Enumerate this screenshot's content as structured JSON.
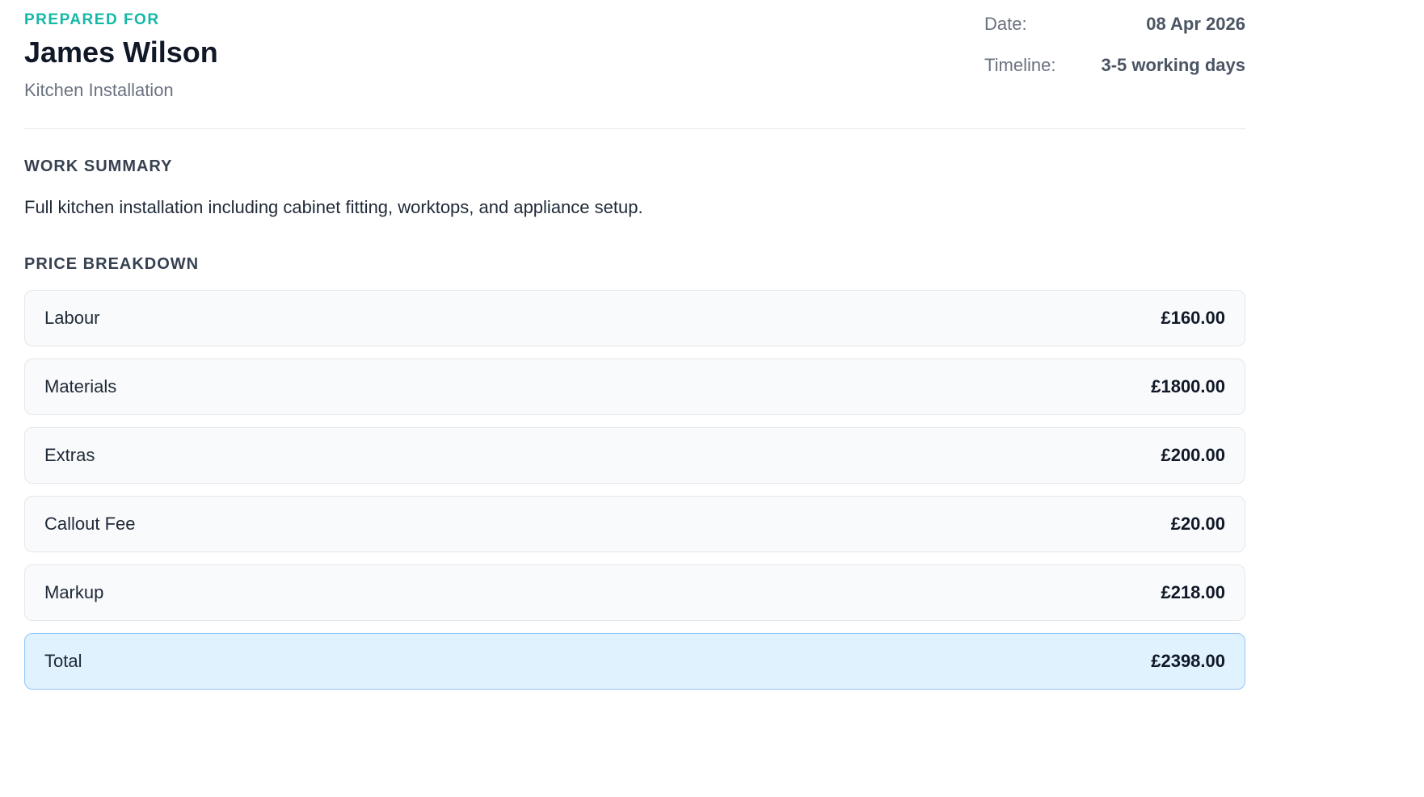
{
  "client": {
    "prepared_label": "PREPARED FOR",
    "name": "James Wilson",
    "project": "Kitchen Installation"
  },
  "meta": {
    "date_label": "Date:",
    "date_value": "08 Apr 2026",
    "timeline_label": "Timeline:",
    "timeline_value": "3-5 working days"
  },
  "work_summary": {
    "title": "WORK SUMMARY",
    "text": "Full kitchen installation including cabinet fitting, worktops, and appliance setup."
  },
  "price_breakdown": {
    "title": "PRICE BREAKDOWN",
    "items": [
      {
        "label": "Labour",
        "amount": "£160.00"
      },
      {
        "label": "Materials",
        "amount": "£1800.00"
      },
      {
        "label": "Extras",
        "amount": "£200.00"
      },
      {
        "label": "Callout Fee",
        "amount": "£20.00"
      },
      {
        "label": "Markup",
        "amount": "£218.00"
      }
    ],
    "total": {
      "label": "Total",
      "amount": "£2398.00"
    }
  },
  "colors": {
    "accent": "#14b8a6",
    "total_background": "#e0f2fe",
    "total_border": "#93c5fd"
  }
}
